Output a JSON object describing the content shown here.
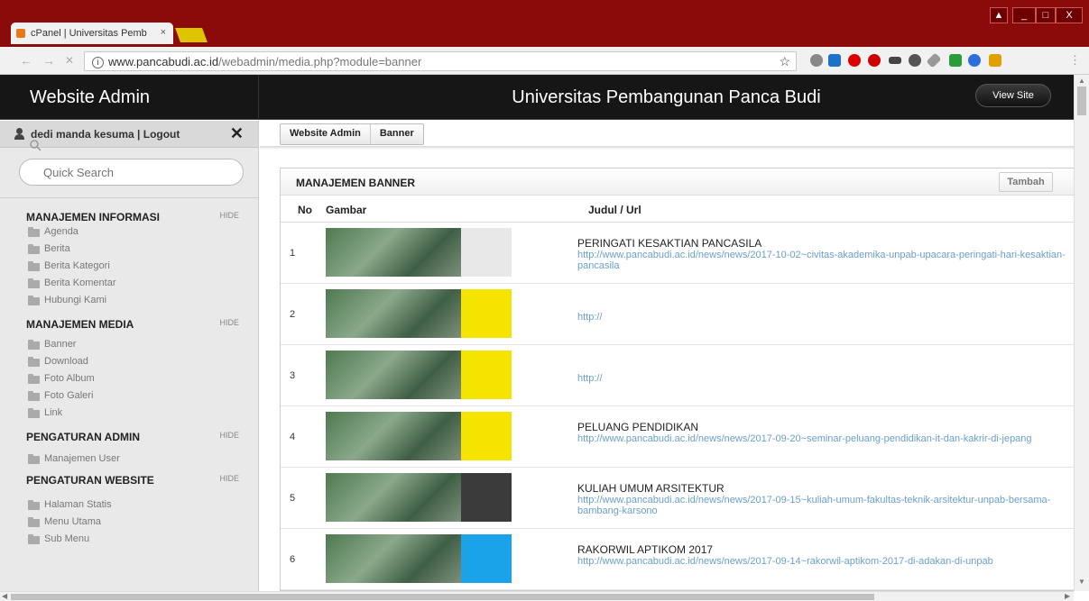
{
  "browser": {
    "tab_title": "cPanel | Universitas Pemb",
    "tab_close": "×",
    "url_host": "www.pancabudi.ac.id",
    "url_path": "/webadmin/media.php?module=banner",
    "window_controls": [
      "_",
      "□",
      "X"
    ]
  },
  "header": {
    "brand": "Website Admin",
    "site_title": "Universitas Pembangunan Panca Budi",
    "view_site_label": "View Site"
  },
  "sidebar": {
    "user_text": "dedi manda kesuma | Logout",
    "close_label": "✕",
    "search_placeholder": "Quick Search",
    "groups": [
      {
        "title": "MANAJEMEN INFORMASI",
        "hide": "HIDE",
        "items": [
          "Agenda",
          "Berita",
          "Berita Kategori",
          "Berita Komentar",
          "Hubungi Kami"
        ]
      },
      {
        "title": "MANAJEMEN MEDIA",
        "hide": "HIDE",
        "items": [
          "Banner",
          "Download",
          "Foto Album",
          "Foto Galeri",
          "Link"
        ]
      },
      {
        "title": "PENGATURAN ADMIN",
        "hide": "HIDE",
        "items": [
          "Manajemen User"
        ]
      },
      {
        "title": "PENGATURAN WEBSITE",
        "hide": "HIDE",
        "items": [
          "Halaman Statis",
          "Menu Utama",
          "Sub Menu"
        ]
      }
    ]
  },
  "breadcrumb": {
    "root": "Website Admin",
    "current": "Banner"
  },
  "panel": {
    "title": "MANAJEMEN BANNER",
    "add_label": "Tambah",
    "columns": {
      "no": "No",
      "image": "Gambar",
      "title_url": "Judul / Url"
    },
    "rows": [
      {
        "no": "1",
        "title": "PERINGATI KESAKTIAN PANCASILA",
        "url": "http://www.pancabudi.ac.id/news/news/2017-10-02~civitas-akademika-unpab-upacara-peringati-hari-kesaktian-pancasila",
        "accent": "#e8e8e8"
      },
      {
        "no": "2",
        "title": "",
        "url": "http://",
        "accent": "#f5e400"
      },
      {
        "no": "3",
        "title": "",
        "url": "http://",
        "accent": "#f5e400"
      },
      {
        "no": "4",
        "title": "PELUANG PENDIDIKAN",
        "url": "http://www.pancabudi.ac.id/news/news/2017-09-20~seminar-peluang-pendidikan-it-dan-kakrir-di-jepang",
        "accent": "#f5e400"
      },
      {
        "no": "5",
        "title": "KULIAH UMUM ARSITEKTUR",
        "url": "http://www.pancabudi.ac.id/news/news/2017-09-15~kuliah-umum-fakultas-teknik-arsitektur-unpab-bersama-bambang-karsono",
        "accent": "#3b3b3b"
      },
      {
        "no": "6",
        "title": "RAKORWIL APTIKOM 2017",
        "url": "http://www.pancabudi.ac.id/news/news/2017-09-14~rakorwil-aptikom-2017-di-adakan-di-unpab",
        "accent": "#1aa3e8"
      }
    ]
  }
}
